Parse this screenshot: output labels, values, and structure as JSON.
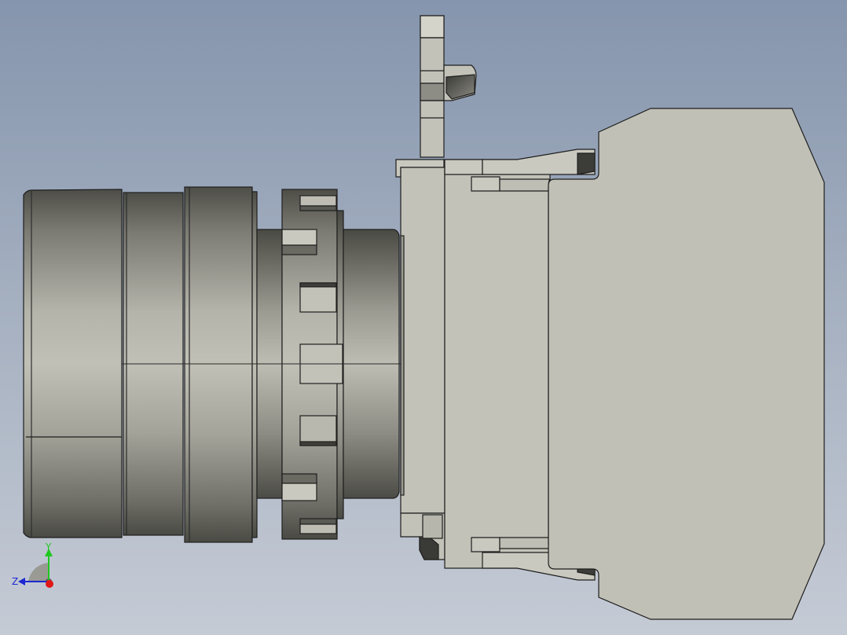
{
  "viewport": {
    "background_top": "#8595ad",
    "background_bottom": "#c5cbd5"
  },
  "model": {
    "name": "push-button-operator-with-contact-block",
    "body_color": "#c2c2b8",
    "edge_color": "#2a2a2a",
    "metal_dark": "#55554e",
    "metal_light": "#b9b9b0"
  },
  "triad": {
    "x_label": "",
    "y_label": "Y",
    "z_label": "Z",
    "y_color": "#1ec81e",
    "z_color": "#1e28d2",
    "x_color": "#e01818"
  }
}
